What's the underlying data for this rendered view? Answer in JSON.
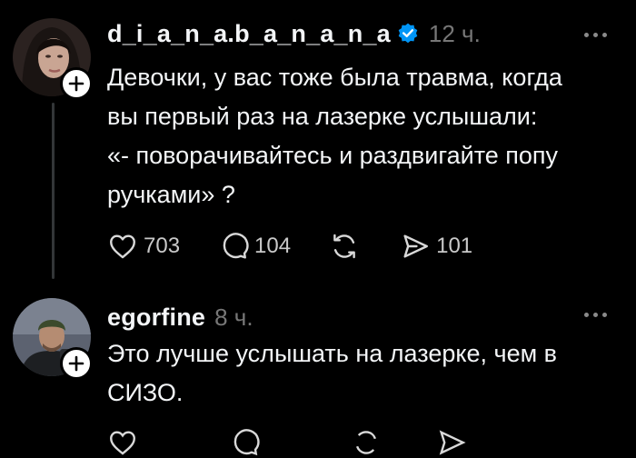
{
  "posts": [
    {
      "username": "d_i_a_n_a.b_a_n_a_n_a",
      "verified": true,
      "time": "12 ч.",
      "lines": [
        "Девочки, у вас тоже была травма, когда",
        "вы первый раз на лазерке услышали:",
        "«- поворачивайтесь и раздвигайте попу",
        "ручками» ?"
      ],
      "actions": {
        "likes": "703",
        "replies": "104",
        "reposts": "",
        "shares": "101"
      }
    },
    {
      "username": "egorfine",
      "verified": false,
      "time": "8 ч.",
      "lines": [
        "Это лучше услышать на лазерке, чем в",
        "СИЗО."
      ]
    }
  ],
  "icons": {
    "like": "heart-icon",
    "reply": "comment-icon",
    "repost": "repost-icon",
    "share": "send-icon",
    "more": "more-icon",
    "follow": "plus-icon",
    "verified": "verified-badge-icon"
  },
  "colors": {
    "background": "#000000",
    "text": "#f3f5f7",
    "muted": "#777777",
    "verified": "#0095f6"
  }
}
